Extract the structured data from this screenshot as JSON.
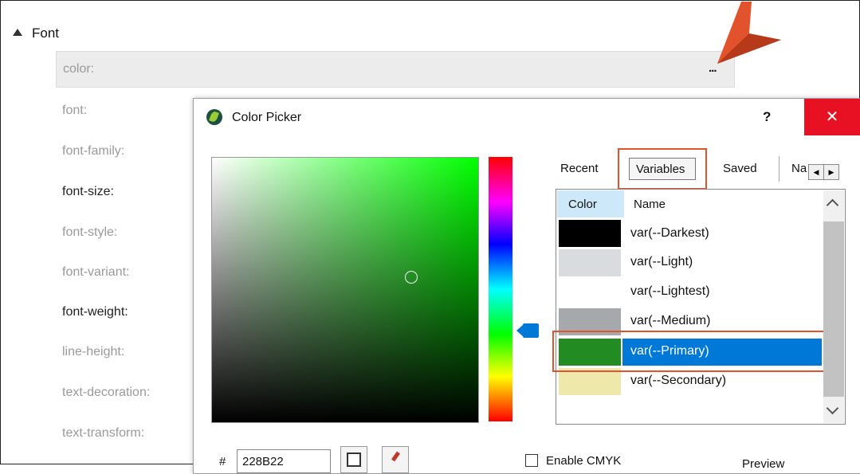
{
  "section": {
    "title": "Font"
  },
  "color_row": {
    "label": "color:",
    "ellipsis": "..."
  },
  "properties": [
    {
      "label": "font:"
    },
    {
      "label": "font-family:"
    },
    {
      "label": "font-size:"
    },
    {
      "label": "font-style:"
    },
    {
      "label": "font-variant:"
    },
    {
      "label": "font-weight:"
    },
    {
      "label": "line-height:"
    },
    {
      "label": "text-decoration:"
    },
    {
      "label": "text-transform:"
    }
  ],
  "dialog": {
    "title": "Color Picker",
    "help": "?",
    "close": "✕",
    "tabs": [
      "Recent",
      "Variables",
      "Saved",
      "Na"
    ],
    "list_headers": {
      "color": "Color",
      "name": "Name"
    },
    "variables": [
      {
        "name": "var(--Darkest)",
        "color": "#000000"
      },
      {
        "name": "var(--Light)",
        "color": "#D8DCDF"
      },
      {
        "name": "var(--Lightest)",
        "color": "#FFFFFF"
      },
      {
        "name": "var(--Medium)",
        "color": "#A6A9AB"
      },
      {
        "name": "var(--Primary)",
        "color": "#228B22"
      },
      {
        "name": "var(--Secondary)",
        "color": "#EEE8AA"
      }
    ],
    "hex_label": "#",
    "hex_value": "228B22",
    "enable_cmyk": "Enable CMYK",
    "preview": "Preview"
  },
  "colors": {
    "selection": "#0078D7",
    "highlight": "#E2532D",
    "close_bg": "#E81123",
    "base_color": "#00FF00"
  }
}
